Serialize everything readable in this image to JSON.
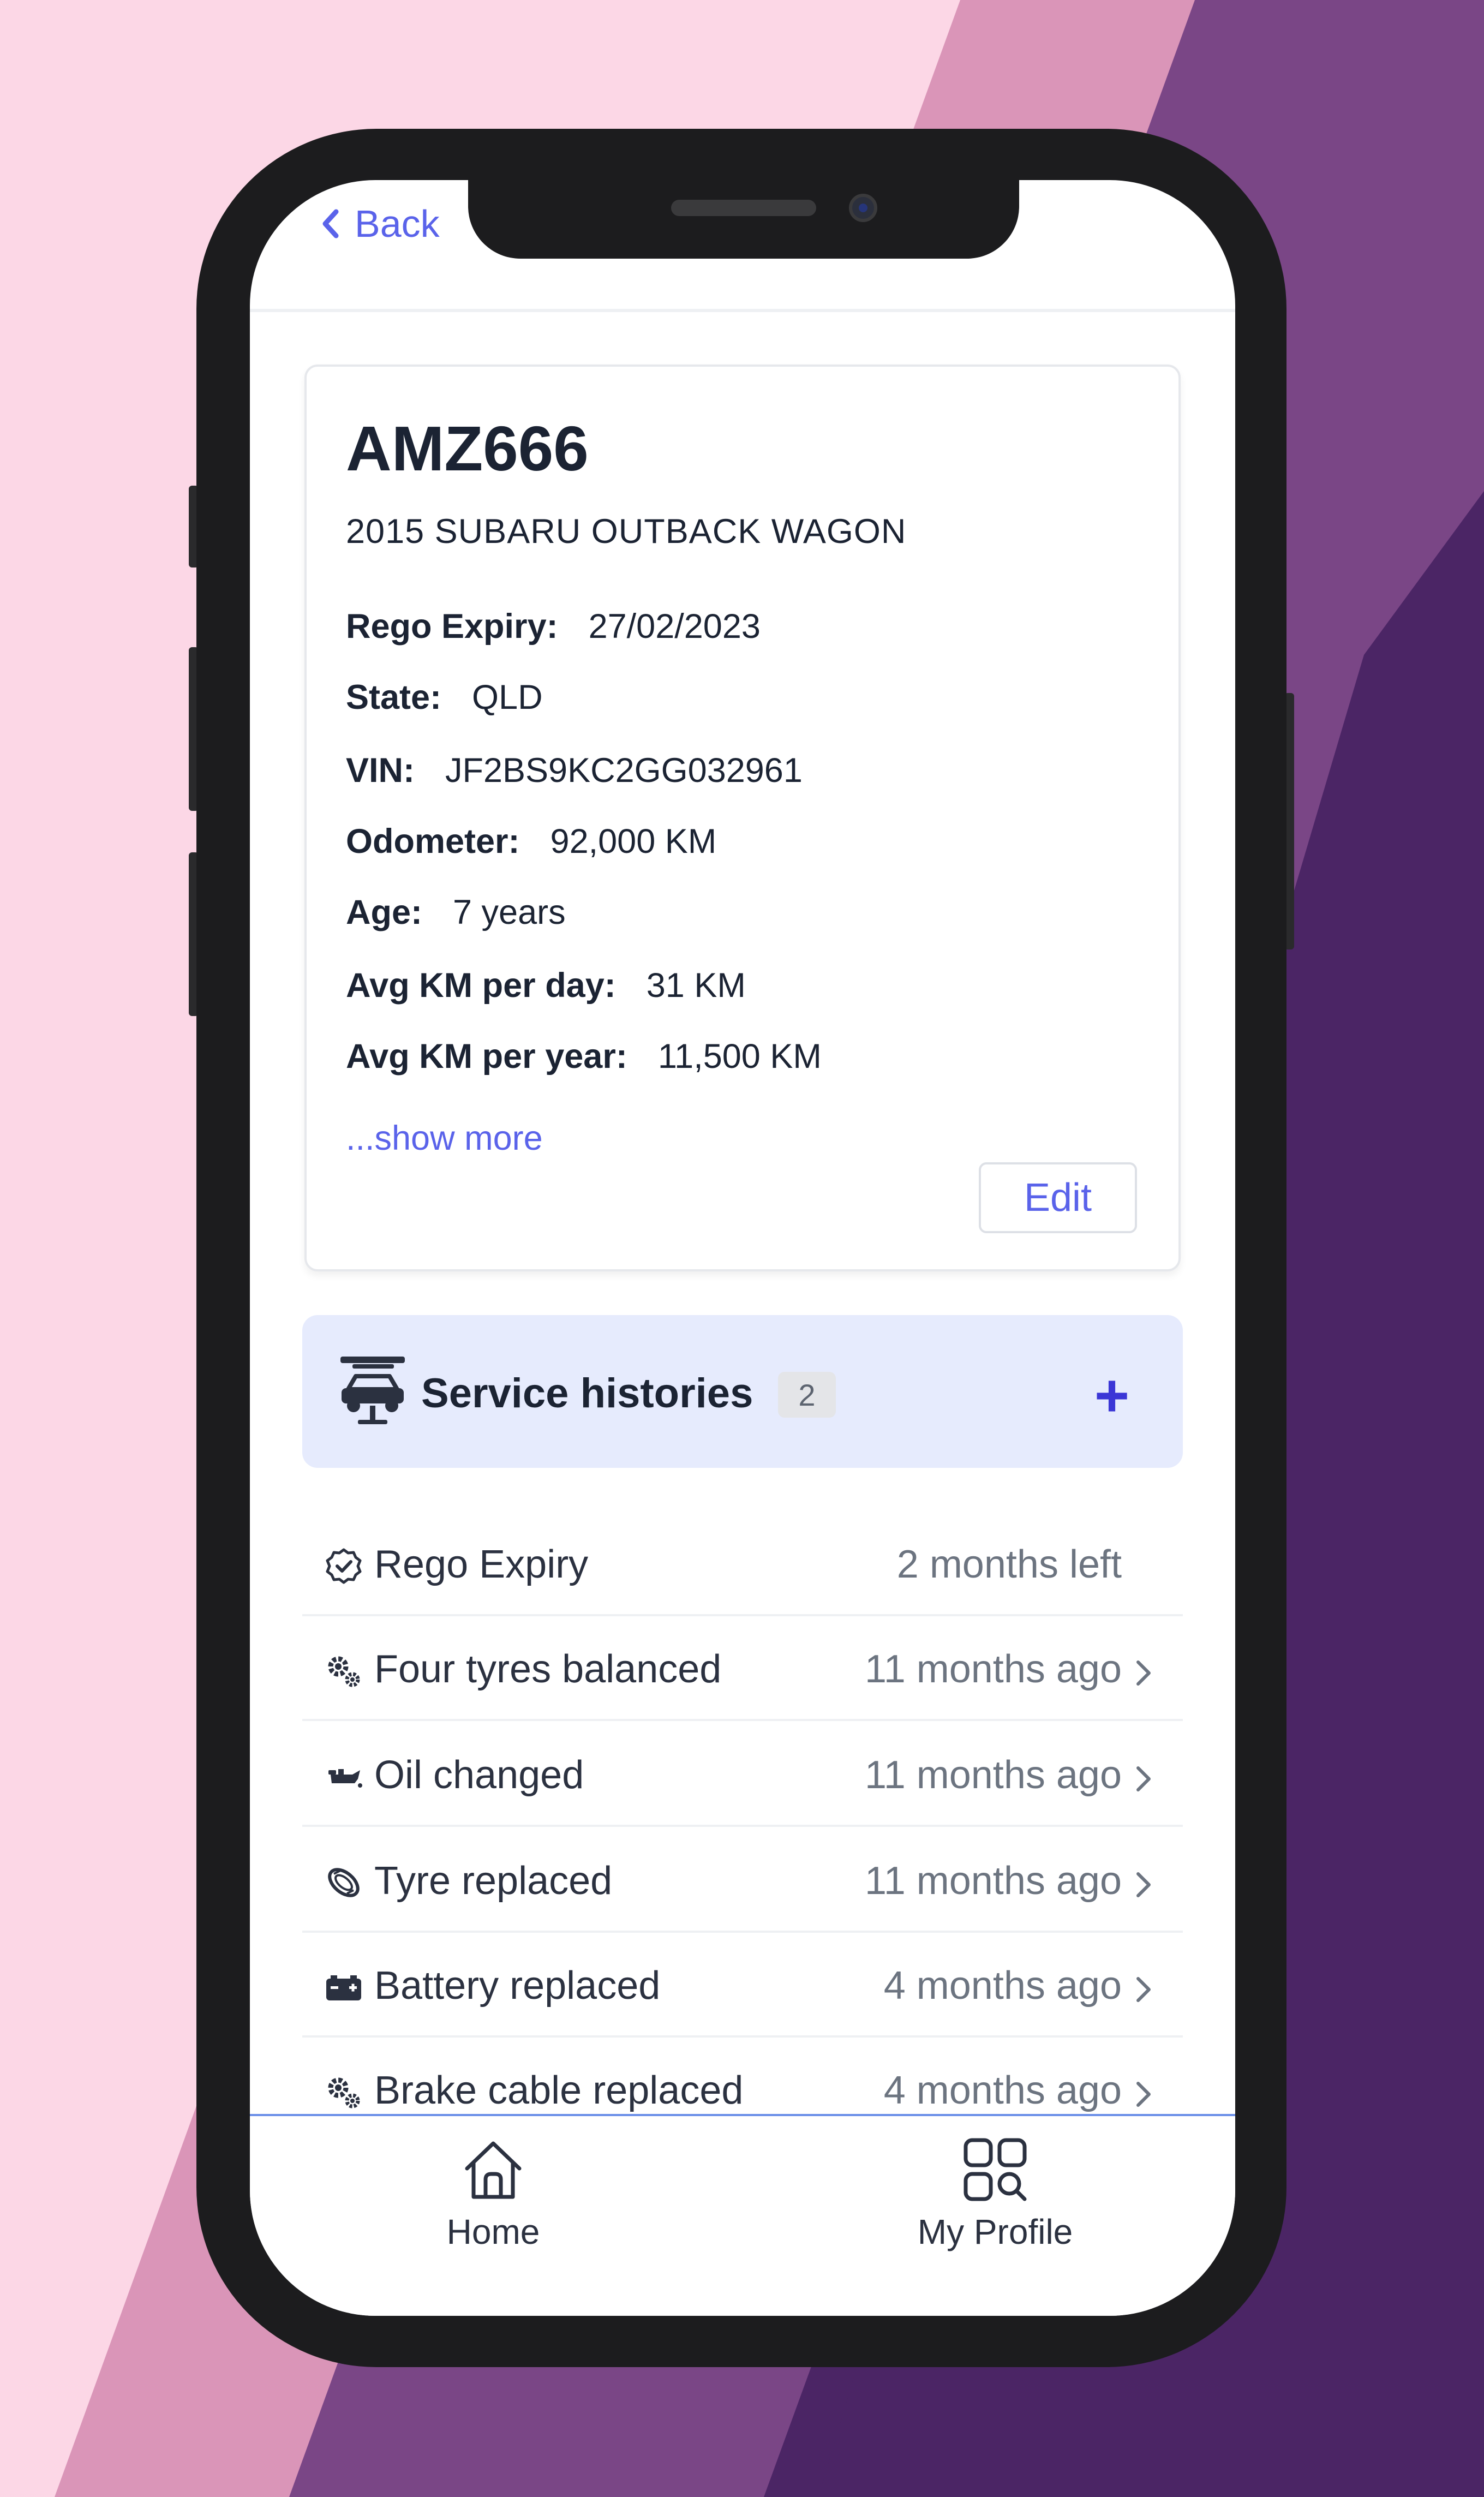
{
  "header": {
    "back_label": "Back"
  },
  "vehicle": {
    "plate": "AMZ666",
    "model": "2015 SUBARU OUTBACK WAGON",
    "details": [
      {
        "key": "Rego Expiry:",
        "value": "27/02/2023"
      },
      {
        "key": "State:",
        "value": "QLD"
      },
      {
        "key": "VIN:",
        "value": "JF2BS9KC2GG032961"
      },
      {
        "key": "Odometer:",
        "value": "92,000 KM"
      },
      {
        "key": "Age:",
        "value": "7 years"
      },
      {
        "key": "Avg KM per day:",
        "value": "31 KM"
      },
      {
        "key": "Avg KM per year:",
        "value": "11,500 KM"
      }
    ],
    "show_more": "...show more",
    "edit_label": "Edit"
  },
  "service_histories": {
    "title": "Service histories",
    "count": "2",
    "add_symbol": "+",
    "icon": "car-lift-icon"
  },
  "history_items": [
    {
      "label": "Rego Expiry",
      "value": "2 months left",
      "icon": "badge-check-icon",
      "chevron": false
    },
    {
      "label": "Four tyres balanced",
      "value": "11 months ago",
      "icon": "gears-icon",
      "chevron": true
    },
    {
      "label": "Oil changed",
      "value": "11 months ago",
      "icon": "oil-can-icon",
      "chevron": true
    },
    {
      "label": "Tyre replaced",
      "value": "11 months ago",
      "icon": "tyre-icon",
      "chevron": true
    },
    {
      "label": "Battery replaced",
      "value": "4 months ago",
      "icon": "battery-icon",
      "chevron": true
    },
    {
      "label": "Brake cable replaced",
      "value": "4 months ago",
      "icon": "gears-icon",
      "chevron": true
    }
  ],
  "tabbar": {
    "home_label": "Home",
    "profile_label": "My Profile"
  },
  "colors": {
    "accent": "#5a63ea",
    "plus": "#3b36d6",
    "service_bg": "#e6ebfd",
    "bg_pink": "#fcd7e6",
    "bg_purple": "#4b2565"
  }
}
